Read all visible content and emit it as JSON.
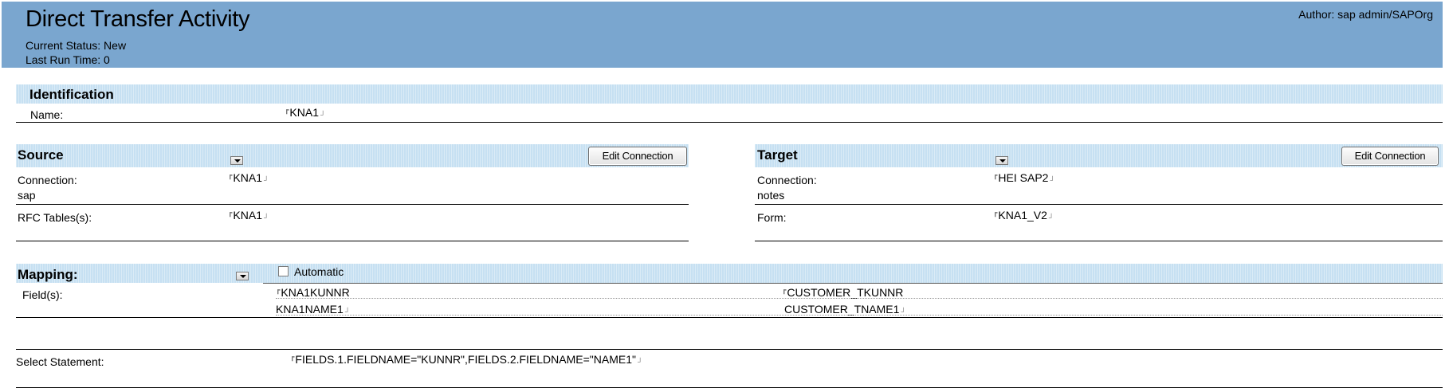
{
  "header": {
    "title": "Direct Transfer Activity",
    "status_label": "Current Status:",
    "status_value": "New",
    "last_run_label": "Last Run Time:",
    "last_run_value": "0",
    "author_label": "Author:",
    "author_value": "sap admin/SAPOrg"
  },
  "identification": {
    "title": "Identification",
    "name_label": "Name:",
    "name_value": "KNA1"
  },
  "source": {
    "title": "Source",
    "edit_button": "Edit Connection",
    "connection_label": "Connection:",
    "connection_type": "sap",
    "connection_value": "KNA1",
    "tables_label": "RFC Tables(s):",
    "tables_value": "KNA1"
  },
  "target": {
    "title": "Target",
    "edit_button": "Edit Connection",
    "connection_label": "Connection:",
    "connection_type": "notes",
    "connection_value": "HEI SAP2",
    "form_label": "Form:",
    "form_value": "KNA1_V2"
  },
  "mapping": {
    "title": "Mapping:",
    "automatic_label": "Automatic",
    "automatic_checked": false,
    "fields_label": "Field(s):",
    "source_fields": [
      "KNA1KUNNR",
      "KNA1NAME1"
    ],
    "target_fields": [
      "CUSTOMER_TKUNNR",
      "CUSTOMER_TNAME1"
    ]
  },
  "select": {
    "label": "Select Statement:",
    "value": "FIELDS.1.FIELDNAME=\"KUNNR\",FIELDS.2.FIELDNAME=\"NAME1\""
  },
  "colors": {
    "header_bg": "#7aa6cf",
    "band_bg": "#c6e0f2"
  }
}
